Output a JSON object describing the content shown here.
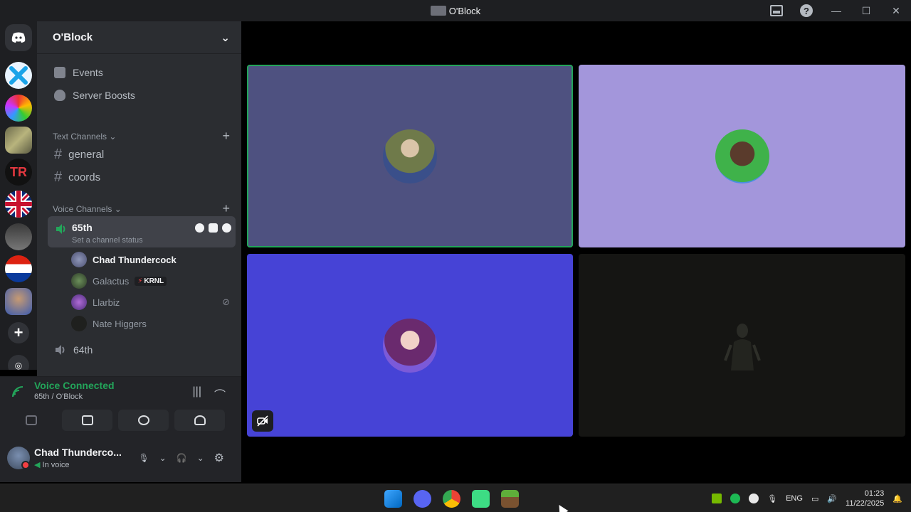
{
  "window": {
    "title": "O'Block"
  },
  "server": {
    "name": "O'Block"
  },
  "sidebar": {
    "nav": [
      {
        "label": "Events",
        "icon": "calendar-icon"
      },
      {
        "label": "Server Boosts",
        "icon": "boost-icon"
      }
    ],
    "text_category": "Text Channels",
    "text_channels": [
      "general",
      "coords"
    ],
    "voice_category": "Voice Channels",
    "active_voice": {
      "name": "65th",
      "status": "Set a channel status"
    },
    "members": [
      {
        "name": "Chad Thundercock"
      },
      {
        "name": "Galactus",
        "badge": "KRNL"
      },
      {
        "name": "Llarbiz"
      },
      {
        "name": "Nate Higgers"
      }
    ],
    "other_voice": {
      "name": "64th"
    }
  },
  "voice_panel": {
    "status": "Voice Connected",
    "channel": "65th",
    "server": "/ O'Block"
  },
  "user_panel": {
    "name": "Chad Thunderco...",
    "status": "In voice"
  },
  "stage": {
    "tile_colors": [
      "#4e5180",
      "#a396db",
      "#4643d6",
      "#151513"
    ]
  },
  "taskbar": {
    "lang": "ENG",
    "time": "01:23",
    "date": "11/22/2025"
  }
}
